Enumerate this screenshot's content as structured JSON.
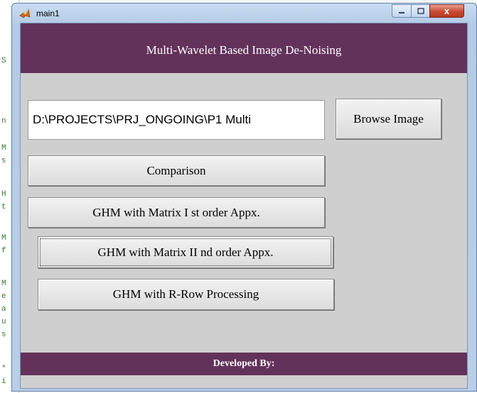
{
  "background_editor": {
    "lines": [
      "S",
      "n",
      "M",
      "s",
      "H",
      "t",
      "M",
      "f",
      "M",
      "e",
      "a",
      "u",
      "s",
      "*",
      "i"
    ]
  },
  "window": {
    "title": "main1",
    "controls": {
      "minimize": "minimize-icon",
      "maximize": "maximize-icon",
      "close_glyph": "x"
    }
  },
  "header": {
    "title": "Multi-Wavelet Based Image De-Noising"
  },
  "path_field": {
    "value": "D:\\PROJECTS\\PRJ_ONGOING\\P1 Multi"
  },
  "buttons": {
    "browse": "Browse Image",
    "comparison": "Comparison",
    "ghm_first": "GHM with Matrix I st order Appx.",
    "ghm_second": "GHM with Matrix II nd order Appx.",
    "ghm_rrow": "GHM with R-Row Processing"
  },
  "footer": {
    "label": "Developed By:"
  },
  "colors": {
    "accent": "#63325b",
    "panel": "#cfcfcf"
  }
}
